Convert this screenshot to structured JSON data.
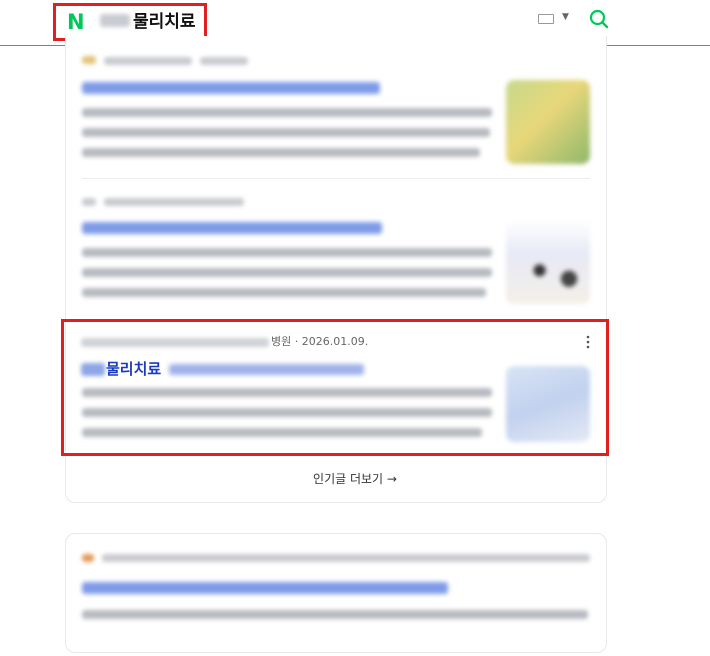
{
  "header": {
    "logo_letter": "N",
    "query_suffix": "물리치료"
  },
  "results": {
    "highlighted": {
      "source_suffix": "병원",
      "date": "· 2026.01.09.",
      "title_suffix": "물리치료"
    },
    "more_link": "인기글 더보기 →"
  },
  "colors": {
    "naver_green": "#03c75a",
    "highlight_red": "#e02020",
    "link_blue": "#1a3bbf"
  }
}
